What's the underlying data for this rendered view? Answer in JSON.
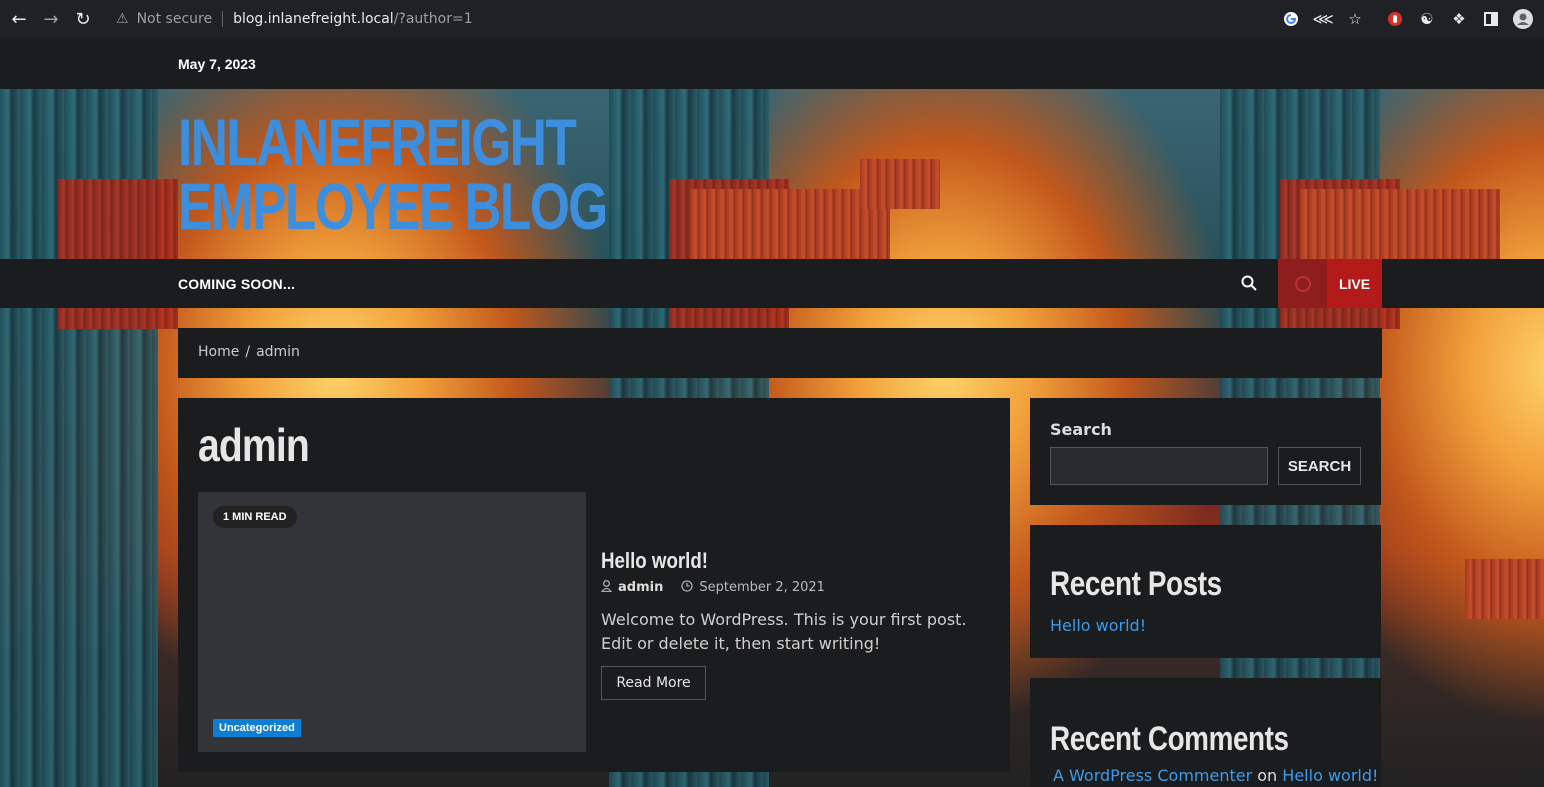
{
  "browser": {
    "security_label": "Not secure",
    "url_host": "blog.inlanefreight.local",
    "url_path": "/?author=1"
  },
  "topbar": {
    "date": "May 7, 2023"
  },
  "header": {
    "site_title_line1": "INLANEFREIGHT",
    "site_title_line2": "EMPLOYEE BLOG"
  },
  "nav": {
    "menu_item": "COMING SOON...",
    "live_label": "LIVE"
  },
  "breadcrumb": {
    "home": "Home",
    "separator": "/",
    "current": "admin"
  },
  "main": {
    "page_title": "admin",
    "post": {
      "read_time": "1 MIN READ",
      "category": "Uncategorized",
      "title": "Hello world!",
      "author": "admin",
      "date": "September 2, 2021",
      "excerpt": "Welcome to WordPress. This is your first post. Edit or delete it, then start writing!",
      "read_more": "Read More"
    }
  },
  "sidebar": {
    "search": {
      "label": "Search",
      "button": "SEARCH",
      "value": ""
    },
    "recent_posts": {
      "title": "Recent Posts",
      "items": [
        "Hello world!"
      ]
    },
    "recent_comments": {
      "title": "Recent Comments",
      "items": [
        {
          "author": "A WordPress Commenter",
          "on": "on",
          "post": "Hello world!"
        }
      ]
    }
  },
  "colors": {
    "accent": "#3d8fde",
    "live_red": "#b31b1b",
    "category_blue": "#0c7fd4"
  }
}
